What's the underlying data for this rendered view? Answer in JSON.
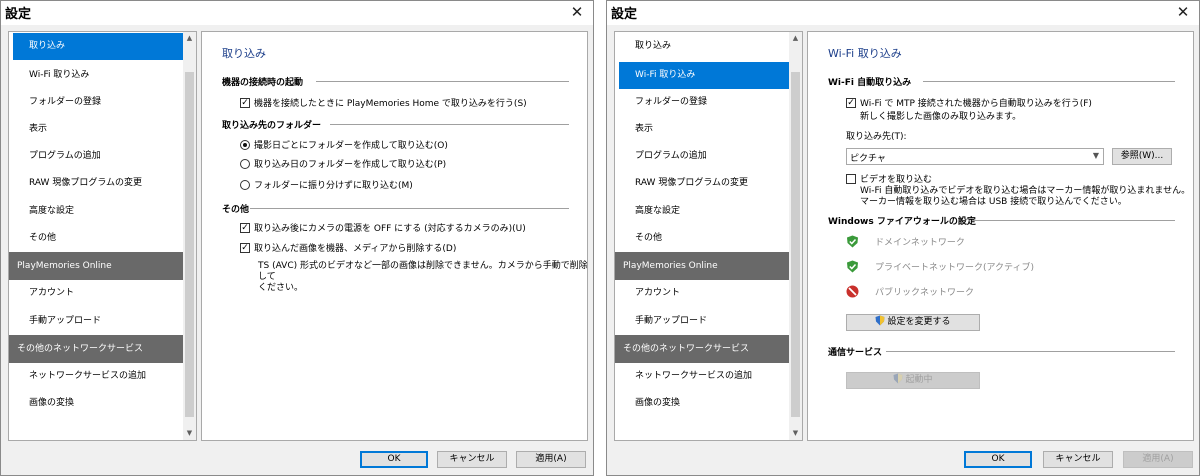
{
  "window1": {
    "title": "設定",
    "sidebar": {
      "items": [
        {
          "label": "取り込み",
          "kind": "item",
          "selected": true
        },
        {
          "label": "Wi-Fi 取り込み",
          "kind": "item"
        },
        {
          "label": "フォルダーの登録",
          "kind": "item"
        },
        {
          "label": "表示",
          "kind": "item"
        },
        {
          "label": "プログラムの追加",
          "kind": "item"
        },
        {
          "label": "RAW 現像プログラムの変更",
          "kind": "item"
        },
        {
          "label": "高度な設定",
          "kind": "item"
        },
        {
          "label": "その他",
          "kind": "item"
        },
        {
          "label": "PlayMemories Online",
          "kind": "header"
        },
        {
          "label": "アカウント",
          "kind": "item"
        },
        {
          "label": "手動アップロード",
          "kind": "item"
        },
        {
          "label": "その他のネットワークサービス",
          "kind": "header"
        },
        {
          "label": "ネットワークサービスの追加",
          "kind": "item"
        },
        {
          "label": "画像の変換",
          "kind": "item"
        }
      ]
    },
    "content": {
      "title": "取り込み",
      "connect_section": "機器の接続時の起動",
      "connect_option": "機器を接続したときに PlayMemories Home で取り込みを行う(S)",
      "dest_section": "取り込み先のフォルダー",
      "dest_options": [
        "撮影日ごとにフォルダーを作成して取り込む(O)",
        "取り込み日のフォルダーを作成して取り込む(P)",
        "フォルダーに振り分けずに取り込む(M)"
      ],
      "other_section": "その他",
      "other_option1": "取り込み後にカメラの電源を OFF にする (対応するカメラのみ)(U)",
      "other_option2": "取り込んだ画像を機器、メディアから削除する(D)",
      "other_note_line1": "TS (AVC) 形式のビデオなど一部の画像は削除できません。カメラから手動で削除して",
      "other_note_line2": "ください。"
    },
    "buttons": {
      "ok": "OK",
      "cancel": "キャンセル",
      "apply": "適用(A)"
    }
  },
  "window2": {
    "title": "設定",
    "sidebar": {
      "items": [
        {
          "label": "取り込み",
          "kind": "item"
        },
        {
          "label": "Wi-Fi 取り込み",
          "kind": "item",
          "selected": true
        },
        {
          "label": "フォルダーの登録",
          "kind": "item"
        },
        {
          "label": "表示",
          "kind": "item"
        },
        {
          "label": "プログラムの追加",
          "kind": "item"
        },
        {
          "label": "RAW 現像プログラムの変更",
          "kind": "item"
        },
        {
          "label": "高度な設定",
          "kind": "item"
        },
        {
          "label": "その他",
          "kind": "item"
        },
        {
          "label": "PlayMemories Online",
          "kind": "header"
        },
        {
          "label": "アカウント",
          "kind": "item"
        },
        {
          "label": "手動アップロード",
          "kind": "item"
        },
        {
          "label": "その他のネットワークサービス",
          "kind": "header"
        },
        {
          "label": "ネットワークサービスの追加",
          "kind": "item"
        },
        {
          "label": "画像の変換",
          "kind": "item"
        }
      ]
    },
    "content": {
      "title": "Wi-Fi 取り込み",
      "auto_section": "Wi-Fi 自動取り込み",
      "auto_option": "Wi-Fi で MTP 接続された機器から自動取り込みを行う(F)",
      "auto_note": "新しく撮影した画像のみ取り込みます。",
      "dest_label": "取り込み先(T):",
      "dest_value": "ピクチャ",
      "browse_button": "参照(W)...",
      "video_option": "ビデオを取り込む",
      "video_note_line1": "Wi-Fi 自動取り込みでビデオを取り込む場合はマーカー情報が取り込まれません。",
      "video_note_line2": "マーカー情報を取り込む場合は USB 接続で取り込んでください。",
      "firewall_section": "Windows ファイアウォールの設定",
      "firewall_items": [
        {
          "label": "ドメインネットワーク",
          "status": "ok"
        },
        {
          "label": "プライベートネットワーク(アクティブ)",
          "status": "ok"
        },
        {
          "label": "パブリックネットワーク",
          "status": "blocked"
        }
      ],
      "change_settings_button": "設定を変更する",
      "comm_section": "通信サービス",
      "running_button": "起動中"
    },
    "buttons": {
      "ok": "OK",
      "cancel": "キャンセル",
      "apply": "適用(A)"
    }
  },
  "colors": {
    "selected": "#0078d7",
    "header_bg": "#696969",
    "title_blue": "#1c3e8a"
  }
}
